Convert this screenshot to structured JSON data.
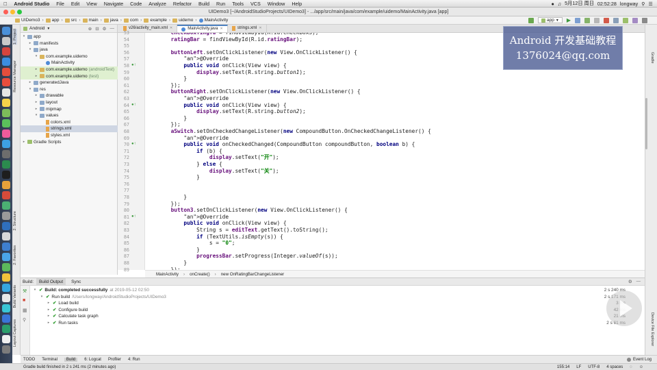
{
  "menubar": {
    "apple": "",
    "app_name": "Android Studio",
    "items": [
      "File",
      "Edit",
      "View",
      "Navigate",
      "Code",
      "Analyze",
      "Refactor",
      "Build",
      "Run",
      "Tools",
      "VCS",
      "Window",
      "Help"
    ],
    "date": "5月12日 周日",
    "time": "02:52:28",
    "user": "longway"
  },
  "window": {
    "title": "UIDemo3 [~/AndroidStudioProjects/UIDemo3] - .../app/src/main/java/com/example/uidemo/MainActivity.java [app]"
  },
  "navbar": {
    "crumbs": [
      "UIDemo3",
      "app",
      "src",
      "main",
      "java",
      "com",
      "example",
      "uidemo",
      "MainActivity"
    ],
    "run_config": "app"
  },
  "project_panel": {
    "view_selector": "Android",
    "items": [
      {
        "label": "app",
        "indent": 0,
        "arrow": "▾",
        "icon": "folder"
      },
      {
        "label": "manifests",
        "indent": 1,
        "arrow": "▸",
        "icon": "folder"
      },
      {
        "label": "java",
        "indent": 1,
        "arrow": "▾",
        "icon": "folder"
      },
      {
        "label": "com.example.uidemo",
        "indent": 2,
        "arrow": "▾",
        "icon": "package"
      },
      {
        "label": "MainActivity",
        "indent": 3,
        "arrow": "",
        "icon": "class"
      },
      {
        "label": "com.example.uidemo",
        "suffix": "(androidTest)",
        "indent": 2,
        "arrow": "▸",
        "icon": "package"
      },
      {
        "label": "com.example.uidemo",
        "suffix": "(test)",
        "indent": 2,
        "arrow": "▸",
        "icon": "package"
      },
      {
        "label": "generatedJava",
        "indent": 1,
        "arrow": "▸",
        "icon": "folder"
      },
      {
        "label": "res",
        "indent": 1,
        "arrow": "▾",
        "icon": "folder"
      },
      {
        "label": "drawable",
        "indent": 2,
        "arrow": "▸",
        "icon": "folder"
      },
      {
        "label": "layout",
        "indent": 2,
        "arrow": "▸",
        "icon": "folder"
      },
      {
        "label": "mipmap",
        "indent": 2,
        "arrow": "▸",
        "icon": "folder"
      },
      {
        "label": "values",
        "indent": 2,
        "arrow": "▾",
        "icon": "folder"
      },
      {
        "label": "colors.xml",
        "indent": 3,
        "arrow": "",
        "icon": "xml"
      },
      {
        "label": "strings.xml",
        "indent": 3,
        "arrow": "",
        "icon": "xml"
      },
      {
        "label": "styles.xml",
        "indent": 3,
        "arrow": "",
        "icon": "xml"
      },
      {
        "label": "Gradle Scripts",
        "indent": 0,
        "arrow": "▸",
        "icon": "gradle"
      }
    ]
  },
  "editor_tabs": [
    {
      "label": "v26/activity_main.xml",
      "active": false
    },
    {
      "label": "MainActivity.java",
      "active": true
    },
    {
      "label": "strings.xml",
      "active": false
    }
  ],
  "code": {
    "first_line": 53,
    "lines": [
      "        checkBoxTingYu = findViewById(R.id.checkBox3);",
      "        ratingBar = findViewById(R.id.ratingBar);",
      "",
      "        buttonLeft.setOnClickListener(new View.OnClickListener() {",
      "            @Override",
      "            public void onClick(View view) {",
      "                display.setText(R.string.button1);",
      "            }",
      "        });",
      "        buttonRight.setOnClickListener(new View.OnClickListener() {",
      "            @Override",
      "            public void onClick(View view) {",
      "                display.setText(R.string.button2);",
      "            }",
      "        });",
      "        aSwitch.setOnCheckedChangeListener(new CompoundButton.OnCheckedChangeListener() {",
      "            @Override",
      "            public void onCheckedChanged(CompoundButton compoundButton, boolean b) {",
      "                if (b) {",
      "                    display.setText(\"开\");",
      "                } else {",
      "                    display.setText(\"关\");",
      "                }",
      "",
      "",
      "            }",
      "        });",
      "        button3.setOnClickListener(new View.OnClickListener() {",
      "            @Override",
      "            public void onClick(View view) {",
      "                String s = editText.getText().toString();",
      "                if (TextUtils.isEmpty(s)) {",
      "                    s = \"0\";",
      "                }",
      "                progressBar.setProgress(Integer.valueOf(s));",
      "            }",
      "        });"
    ]
  },
  "watermark": {
    "line1": "Android 开发基础教程",
    "line2": "1376024@qq.com"
  },
  "code_breadcrumb": [
    "MainActivity",
    "onCreate()",
    "new OnRatingBarChangeListener"
  ],
  "build_panel": {
    "label": "Build:",
    "tabs": [
      "Build Output",
      "Sync"
    ],
    "rows": [
      {
        "text": "Build: completed successfully",
        "detail": "at 2019-05-12 02:50",
        "indent": 0,
        "duration": "2 s 240 ms"
      },
      {
        "text": "Run build",
        "detail": "/Users/longway/AndroidStudioProjects/UIDemo3",
        "indent": 1,
        "duration": "2 s 171 ms"
      },
      {
        "text": "Load build",
        "detail": "",
        "indent": 2,
        "duration": "3 ms"
      },
      {
        "text": "Configure build",
        "detail": "",
        "indent": 2,
        "duration": "42 ms"
      },
      {
        "text": "Calculate task graph",
        "detail": "",
        "indent": 2,
        "duration": "21 ms"
      },
      {
        "text": "Run tasks",
        "detail": "",
        "indent": 2,
        "duration": "2 s 61 ms"
      }
    ]
  },
  "bottom_tabs": [
    "TODO",
    "Terminal",
    "Build",
    "6: Logcat",
    "Profiler",
    "4: Run"
  ],
  "event_log": "Event Log",
  "status": {
    "message": "Gradle build finished in 2 s 241 ms (2 minutes ago)",
    "position": "155:14",
    "line_sep": "LF",
    "encoding": "UTF-8",
    "indent": "4 spaces"
  },
  "left_strip_labels": [
    "1: Project",
    "Resource Manager",
    "2: Structure",
    "2: Favorites",
    "Build Variants",
    "Layout Captures"
  ],
  "right_strip_labels": [
    "Gradle",
    "Device File Explorer"
  ],
  "colors": {
    "accent": "#4e82c0",
    "keyword": "#00007f",
    "annotation": "#7f7f00",
    "field": "#660e7a",
    "string": "#007f00"
  }
}
